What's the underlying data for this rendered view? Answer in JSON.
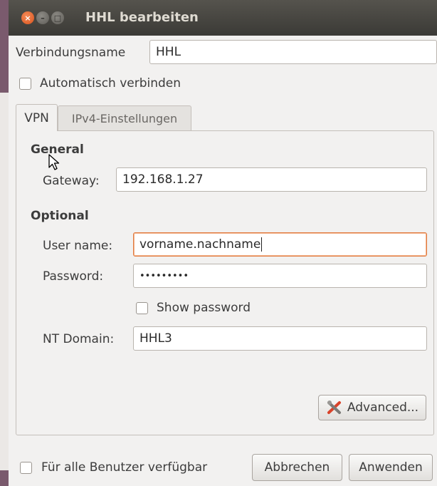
{
  "window": {
    "title": "HHL bearbeiten",
    "close_glyph": "×",
    "minimize_glyph": "–",
    "maximize_glyph": "□"
  },
  "connection": {
    "name_label": "Verbindungsname",
    "name_value": "HHL",
    "auto_connect_label": "Automatisch verbinden",
    "auto_connect_checked": false
  },
  "tabs": [
    {
      "label": "VPN",
      "active": true
    },
    {
      "label": "IPv4-Einstellungen",
      "active": false
    }
  ],
  "vpn": {
    "general_heading": "General",
    "gateway_label": "Gateway:",
    "gateway_value": "192.168.1.27",
    "optional_heading": "Optional",
    "username_label": "User name:",
    "username_value": "vorname.nachname",
    "password_label": "Password:",
    "password_value": "•••••••••",
    "show_password_label": "Show password",
    "show_password_checked": false,
    "nt_domain_label": "NT Domain:",
    "nt_domain_value": "HHL3",
    "advanced_label": "Advanced...",
    "advanced_icon": "tools-icon"
  },
  "footer": {
    "all_users_label": "Für alle Benutzer verfügbar",
    "all_users_checked": false,
    "cancel_label": "Abbrechen",
    "apply_label": "Anwenden"
  },
  "colors": {
    "titlebar": "#3f3e3a",
    "close_button": "#e2622a",
    "focus_border": "#e07b40",
    "window_bg": "#f2f1f0"
  }
}
